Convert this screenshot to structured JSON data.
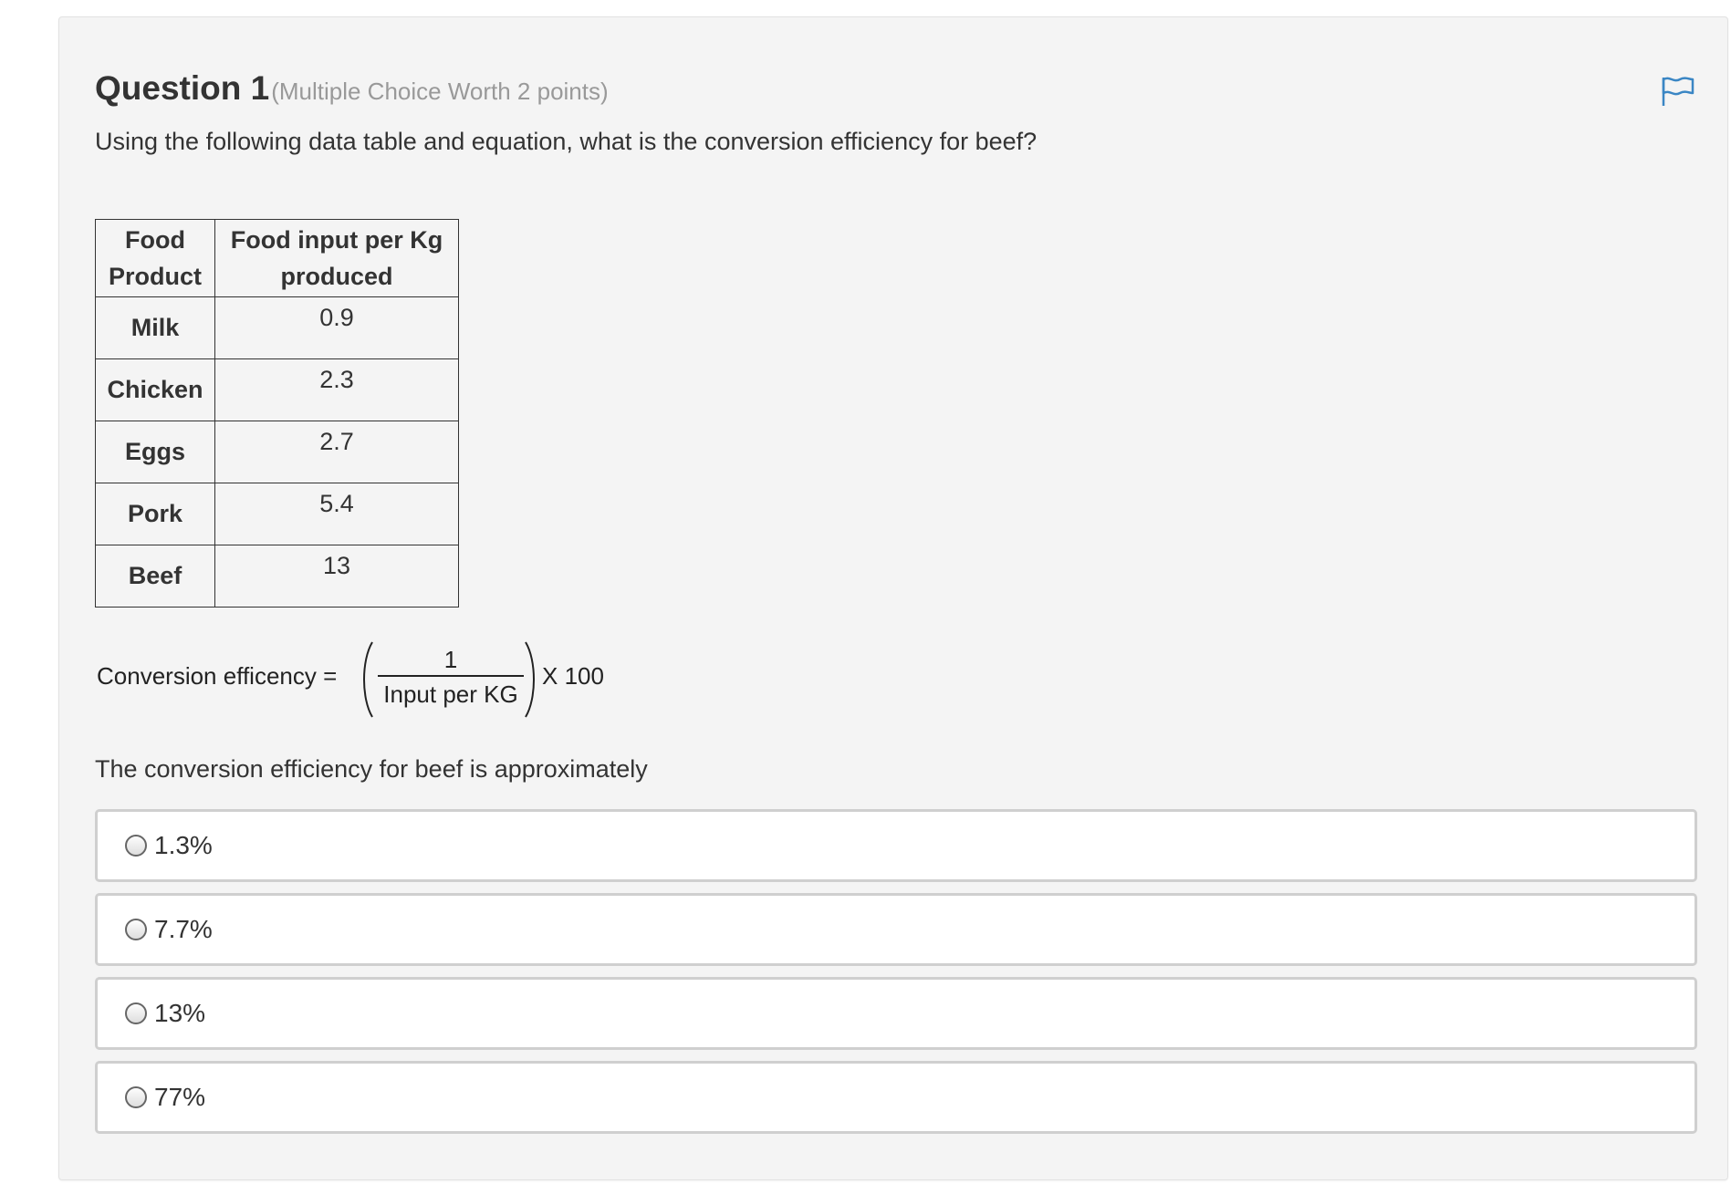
{
  "question": {
    "title": "Question 1",
    "worth": "(Multiple Choice Worth 2 points)",
    "prompt": "Using the following data table and equation, what is the conversion efficiency for beef?",
    "stem": "The conversion efficiency for beef is approximately",
    "flag_icon": "flag-icon"
  },
  "table": {
    "headers": [
      "Food Product",
      "Food input per Kg produced"
    ],
    "rows": [
      {
        "product": "Milk",
        "value": "0.9"
      },
      {
        "product": "Chicken",
        "value": "2.3"
      },
      {
        "product": "Eggs",
        "value": "2.7"
      },
      {
        "product": "Pork",
        "value": "5.4"
      },
      {
        "product": "Beef",
        "value": "13"
      }
    ]
  },
  "equation": {
    "label": "Conversion efficency =",
    "numerator": "1",
    "denominator": "Input per KG",
    "multiplier": "X 100"
  },
  "options": [
    {
      "label": "1.3%",
      "selected": false
    },
    {
      "label": "7.7%",
      "selected": false
    },
    {
      "label": "13%",
      "selected": false
    },
    {
      "label": "77%",
      "selected": false
    }
  ],
  "colors": {
    "panel_bg": "#f4f4f4",
    "flag_blue": "#3a86c4",
    "option_border": "#cfcfcf",
    "muted_text": "#999999"
  }
}
